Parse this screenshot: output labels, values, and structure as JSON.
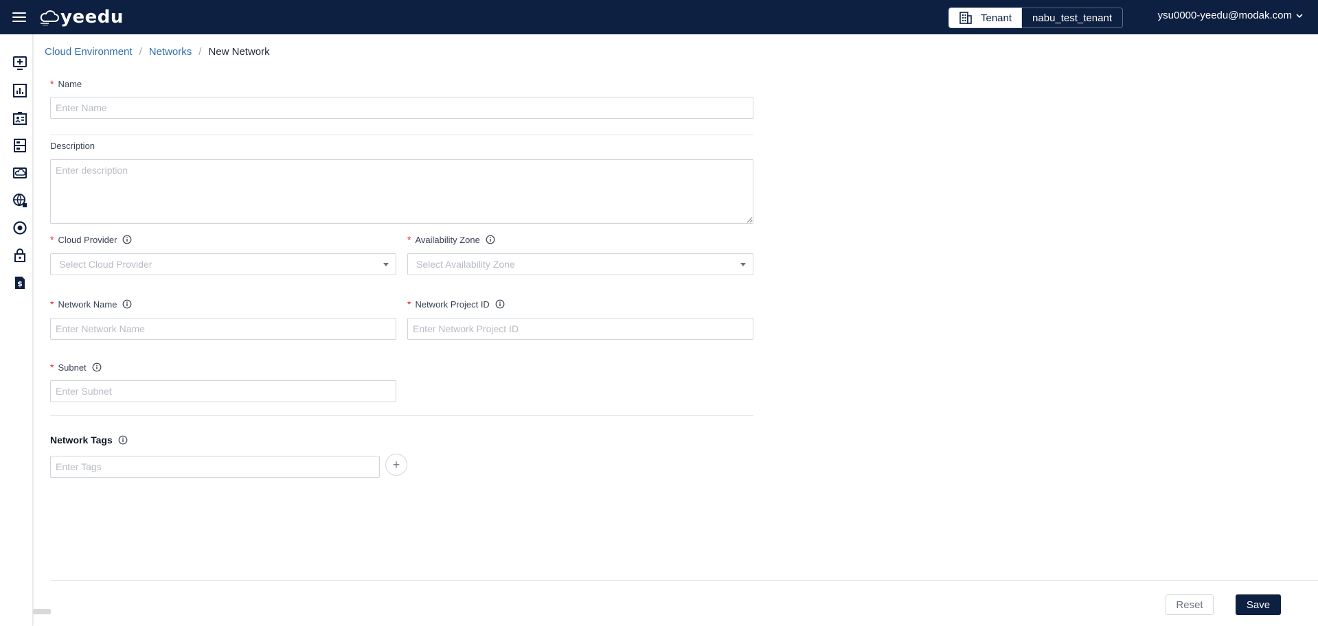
{
  "header": {
    "brand": "yeedu",
    "tenant_label": "Tenant",
    "tenant_name": "nabu_test_tenant",
    "user_email": "ysu0000-yeedu@modak.com"
  },
  "sidebar": {
    "icons": [
      "monitor-plus-icon",
      "bar-chart-icon",
      "id-card-icon",
      "server-rack-icon",
      "cloud-drive-icon",
      "globe-network-icon",
      "target-icon",
      "lock-icon",
      "billing-icon"
    ]
  },
  "breadcrumb": {
    "items": [
      "Cloud Environment",
      "Networks",
      "New Network"
    ]
  },
  "form": {
    "name": {
      "label": "Name",
      "placeholder": "Enter Name"
    },
    "description": {
      "label": "Description",
      "placeholder": "Enter description"
    },
    "cloud_provider": {
      "label": "Cloud Provider",
      "placeholder": "Select Cloud Provider"
    },
    "availability_zone": {
      "label": "Availability Zone",
      "placeholder": "Select Availability Zone"
    },
    "network_name": {
      "label": "Network Name",
      "placeholder": "Enter Network Name"
    },
    "network_project_id": {
      "label": "Network Project ID",
      "placeholder": "Enter Network Project ID"
    },
    "subnet": {
      "label": "Subnet",
      "placeholder": "Enter Subnet"
    },
    "network_tags": {
      "title": "Network Tags",
      "placeholder": "Enter Tags",
      "add_symbol": "+"
    },
    "required_mark": "*"
  },
  "actions": {
    "reset_label": "Reset",
    "save_label": "Save"
  },
  "colors": {
    "nav_bg": "#0e2041",
    "link": "#2f6db5",
    "required": "#e02424"
  }
}
